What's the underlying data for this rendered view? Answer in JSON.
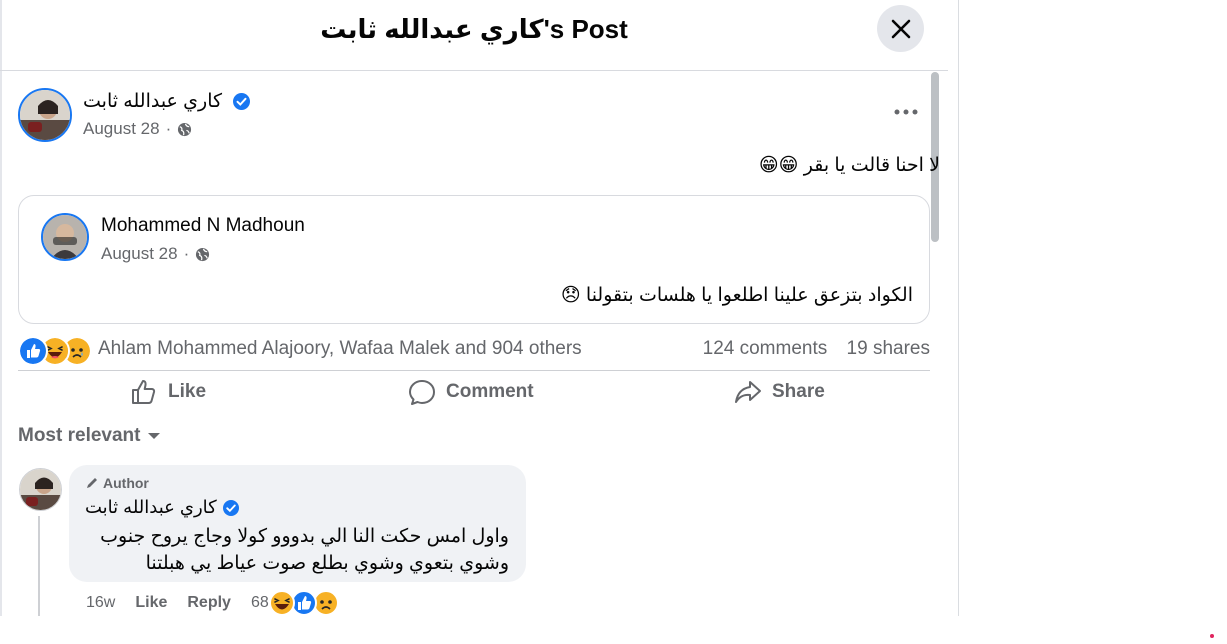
{
  "header": {
    "title": "كاري عبدالله ثابت's Post"
  },
  "post": {
    "author": "كاري عبدالله ثابت",
    "date": "August 28",
    "text": "لا احنا قالت يا بقر",
    "text_emoji": "😁😁"
  },
  "shared": {
    "author": "Mohammed N Madhoun",
    "date": "August 28",
    "text": "الكواد بتزعق علينا اطلعوا يا هلسات بتقولنا",
    "text_emoji": "😞"
  },
  "reactions": {
    "names": "Ahlam Mohammed Alajoory, Wafaa Malek and 904 others",
    "comments": "124 comments",
    "shares": "19 shares",
    "types": [
      "like-icon",
      "haha-icon",
      "sad-icon"
    ]
  },
  "actions": {
    "like": "Like",
    "comment": "Comment",
    "share": "Share"
  },
  "sort": {
    "label": "Most relevant"
  },
  "comment": {
    "badge": "Author",
    "author": "كاري عبدالله ثابت",
    "line1": "واول امس حكت النا الي بدووو كولا وجاج يروح جنوب",
    "line2": "وشوي بتعوي وشوي بطلع صوت عياط يي هبلتنا",
    "age": "16w",
    "like": "Like",
    "reply": "Reply",
    "reaction_count": "68"
  },
  "colors": {
    "accent": "#1877f2",
    "secondary_text": "#65676b",
    "divider": "#ced0d4"
  }
}
